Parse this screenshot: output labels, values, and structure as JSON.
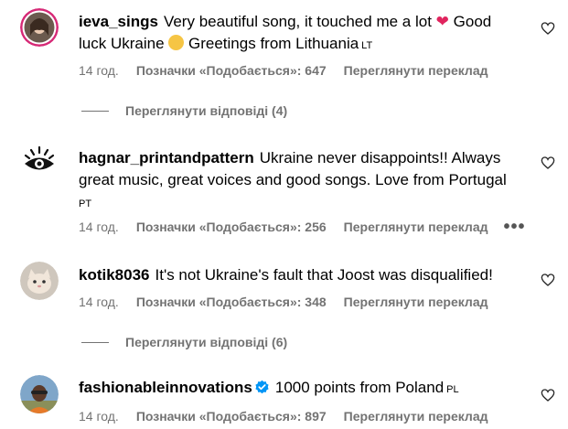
{
  "comments": [
    {
      "username": "ieva_sings",
      "text_a": "Very beautiful song, it touched me a lot",
      "text_b": "Good luck Ukraine",
      "text_c": "Greetings from Lithuania",
      "flag": "LT",
      "time": "14 год.",
      "likes": "Позначки «Подобається»: 647",
      "translate": "Переглянути переклад",
      "replies": "Переглянути відповіді (4)"
    },
    {
      "username": "hagnar_printandpattern",
      "text": "Ukraine never disappoints!! Always great music, great voices and good songs. Love from Portugal",
      "flag": "PT",
      "time": "14 год.",
      "likes": "Позначки «Подобається»: 256",
      "translate": "Переглянути переклад",
      "more": "•••"
    },
    {
      "username": "kotik8036",
      "text": "It's not Ukraine's fault that Joost was disqualified!",
      "time": "14 год.",
      "likes": "Позначки «Подобається»: 348",
      "translate": "Переглянути переклад",
      "replies": "Переглянути відповіді (6)"
    },
    {
      "username": "fashionableinnovations",
      "text": "1000 points from Poland",
      "flag": "PL",
      "time": "14 год.",
      "likes": "Позначки «Подобається»: 897",
      "translate": "Переглянути переклад"
    }
  ],
  "icons": {
    "like": "heart-outline-icon",
    "verified": "verified-badge-icon"
  }
}
